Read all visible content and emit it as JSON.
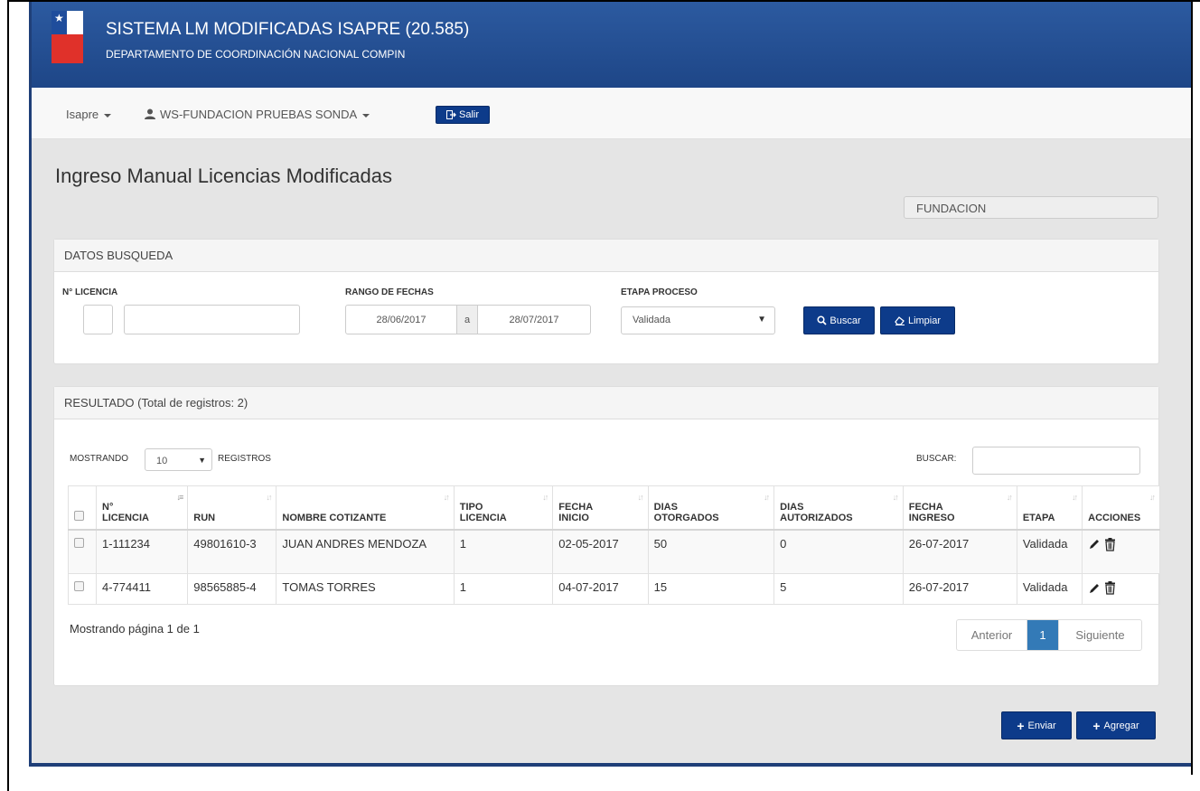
{
  "header": {
    "title": "SISTEMA LM MODIFICADAS ISAPRE (20.585)",
    "subtitle": "DEPARTAMENTO DE COORDINACIÓN NACIONAL COMPIN"
  },
  "nav": {
    "isapre_label": "Isapre",
    "user_label": "WS-FUNDACION PRUEBAS SONDA",
    "logout_label": "Salir"
  },
  "page": {
    "title": "Ingreso Manual Licencias Modificadas",
    "entity": "FUNDACION"
  },
  "search": {
    "panel_title": "DATOS BUSQUEDA",
    "license_label": "N° LICENCIA",
    "license_prefix": "",
    "license_number": "",
    "date_range_label": "RANGO DE FECHAS",
    "date_from": "28/06/2017",
    "date_sep": "a",
    "date_to": "28/07/2017",
    "stage_label": "ETAPA PROCESO",
    "stage_value": "Validada",
    "search_button": "Buscar",
    "clear_button": "Limpiar"
  },
  "results": {
    "panel_title": "RESULTADO (Total de registros: 2)",
    "show_label": "MOSTRANDO",
    "page_size": "10",
    "records_label": "REGISTROS",
    "filter_label": "BUSCAR:",
    "filter_value": "",
    "columns": {
      "license_1": "N°",
      "license_2": "LICENCIA",
      "run": "RUN",
      "name": "NOMBRE COTIZANTE",
      "type_1": "TIPO",
      "type_2": "LICENCIA",
      "start_1": "FECHA",
      "start_2": "INICIO",
      "granted_1": "DIAS",
      "granted_2": "OTORGADOS",
      "authorized_1": "DIAS",
      "authorized_2": "AUTORIZADOS",
      "entry_1": "FECHA",
      "entry_2": "INGRESO",
      "stage": "ETAPA",
      "actions": "ACCIONES"
    },
    "rows": [
      {
        "license": "1-111234",
        "run": "49801610-3",
        "name": "JUAN ANDRES MENDOZA",
        "type": "1",
        "start": "02-05-2017",
        "granted": "50",
        "authorized": "0",
        "entry": "26-07-2017",
        "stage": "Validada"
      },
      {
        "license": "4-774411",
        "run": "98565885-4",
        "name": "TOMAS TORRES",
        "type": "1",
        "start": "04-07-2017",
        "granted": "15",
        "authorized": "5",
        "entry": "26-07-2017",
        "stage": "Validada"
      }
    ],
    "page_info": "Mostrando página 1 de 1",
    "pager": {
      "prev": "Anterior",
      "current": "1",
      "next": "Siguiente"
    }
  },
  "footer_actions": {
    "send": "Enviar",
    "add": "Agregar"
  },
  "colors": {
    "header": "#1e4687",
    "primary_button": "#0d3b8a",
    "active_page": "#337ab7"
  }
}
